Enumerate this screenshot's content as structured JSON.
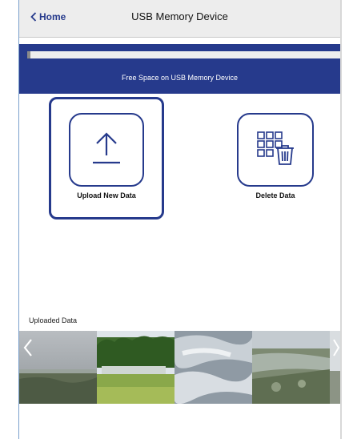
{
  "header": {
    "back_label": "Home",
    "title": "USB Memory Device"
  },
  "storage": {
    "label": "Free Space on USB Memory Device",
    "used_fraction": 0.01
  },
  "actions": {
    "upload_label": "Upload New Data",
    "delete_label": "Delete Data"
  },
  "uploaded": {
    "title": "Uploaded Data"
  },
  "colors": {
    "accent": "#263a8c",
    "header_bg": "#ededed"
  },
  "icons": {
    "back": "chevron-left-icon",
    "upload": "upload-arrow-icon",
    "delete": "grid-trash-icon",
    "prev": "chevron-left-icon",
    "next": "chevron-right-icon"
  }
}
